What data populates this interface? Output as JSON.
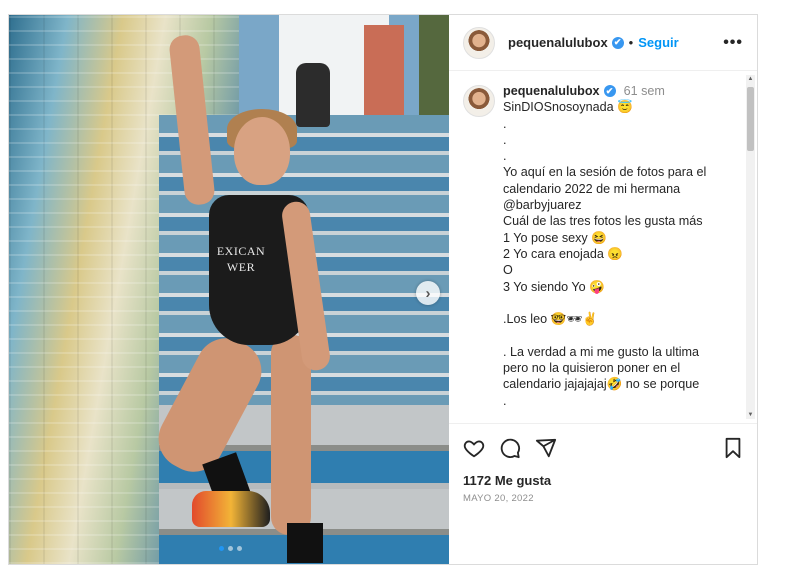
{
  "post": {
    "username": "pequenalulubox",
    "verified_mark": "✔",
    "follow_label": "Seguir",
    "more_label": "•••",
    "separator": "•"
  },
  "photo": {
    "shirt_line1": "EXICAN",
    "shirt_line2": "WER",
    "next_label": "›",
    "carousel_count": 3,
    "carousel_active": 1
  },
  "caption": {
    "username": "pequenalulubox",
    "time": "61 sem",
    "lines": [
      "SinDIOSnosoynada 😇",
      ".",
      ".",
      ".",
      "Yo aquí en la sesión de fotos para el",
      "calendario 2022 de mi hermana",
      "@barbyjuarez",
      "Cuál de las tres fotos les gusta más",
      "1 Yo pose sexy 😆",
      "2 Yo cara enojada 😠",
      "O",
      "3 Yo siendo Yo 🤪",
      "",
      ".Los leo 🤓🕶✌",
      "",
      ". La verdad a mi me gusto la ultima",
      "pero no la quisieron poner en el",
      "calendario jajajajaj🤣 no se porque",
      "."
    ]
  },
  "scrollbar": {
    "up": "▲",
    "down": "▼"
  },
  "icons": {
    "like": "heart-icon",
    "comment": "comment-icon",
    "share": "share-icon",
    "save": "bookmark-icon"
  },
  "likes_text": "1172 Me gusta",
  "date_text": "MAYO 20, 2022",
  "colors": {
    "accent": "#0095f6",
    "verified": "#3897f0",
    "muted": "#8e8e8e",
    "text": "#262626"
  }
}
